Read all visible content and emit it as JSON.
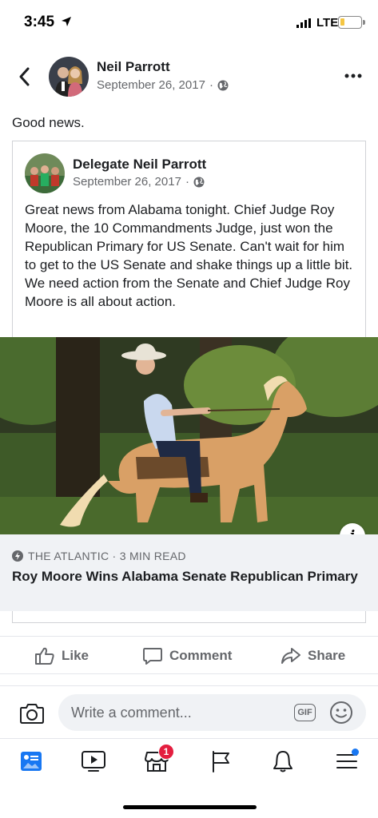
{
  "status_bar": {
    "time": "3:45",
    "network": "LTE"
  },
  "post": {
    "author": "Neil Parrott",
    "date": "September 26, 2017",
    "separator": "·",
    "privacy_icon": "globe-icon",
    "text": "Good news."
  },
  "shared_post": {
    "author": "Delegate Neil Parrott",
    "date": "September 26, 2017",
    "separator": "·",
    "privacy_icon": "globe-icon",
    "body": "Great news from Alabama tonight.  Chief Judge Roy Moore, the 10 Commandments Judge, just won the Republican Primary for US Senate.  Can't wait for him to get to the US Senate and shake things up a little bit.  We need action from the Senate and Chief Judge Roy Moore is all about action."
  },
  "link": {
    "source": "THE ATLANTIC · 3 MIN READ",
    "title": "Roy Moore Wins Alabama Senate Republican Primary",
    "info_label": "i"
  },
  "actions": {
    "like": "Like",
    "comment": "Comment",
    "share": "Share"
  },
  "comment_bar": {
    "placeholder": "Write a comment...",
    "gif_label": "GIF"
  },
  "tab_bar": {
    "items": [
      "news-feed",
      "watch",
      "marketplace",
      "pages",
      "notifications",
      "menu"
    ],
    "marketplace_badge": "1",
    "active": "news-feed",
    "active_color": "#1877f2"
  },
  "colors": {
    "secondary_text": "#65676b",
    "link_card_bg": "#f0f2f5",
    "badge": "#e41e3f"
  }
}
